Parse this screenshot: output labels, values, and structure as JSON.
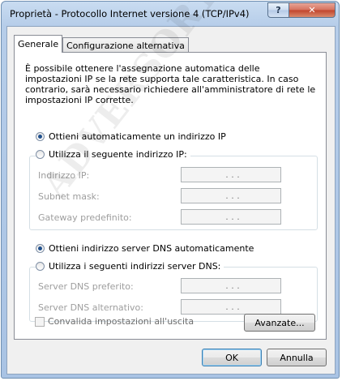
{
  "window": {
    "title": "Proprietà - Protocollo Internet versione 4 (TCP/IPv4)",
    "help_label": "?",
    "close_label": "✕"
  },
  "tabs": [
    {
      "label": "Generale",
      "active": true
    },
    {
      "label": "Configurazione alternativa",
      "active": false
    }
  ],
  "description": "È possibile ottenere l'assegnazione automatica delle impostazioni IP se la rete supporta tale caratteristica. In caso contrario, sarà necessario richiedere all'amministratore di rete le impostazioni IP corrette.",
  "ip": {
    "auto_label": "Ottieni automaticamente un indirizzo IP",
    "auto_checked": true,
    "manual_label": "Utilizza il seguente indirizzo IP:",
    "manual_checked": false,
    "fields": [
      {
        "label": "Indirizzo IP:",
        "value": ". . ."
      },
      {
        "label": "Subnet mask:",
        "value": ". . ."
      },
      {
        "label": "Gateway predefinito:",
        "value": ". . ."
      }
    ]
  },
  "dns": {
    "auto_label": "Ottieni indirizzo server DNS automaticamente",
    "auto_checked": true,
    "manual_label": "Utilizza i seguenti indirizzi server DNS:",
    "manual_checked": false,
    "fields": [
      {
        "label": "Server DNS preferito:",
        "value": ". . ."
      },
      {
        "label": "Server DNS alternativo:",
        "value": ". . ."
      }
    ]
  },
  "validate_label": "Convalida impostazioni all'uscita",
  "advanced_label": "Avanzate...",
  "ok_label": "OK",
  "cancel_label": "Annulla",
  "watermark": "ADVERSORTAUDIT.NET",
  "colors": {
    "accent": "#3c7fb1",
    "title_bar": "#b6cde9",
    "close_button": "#c1432b"
  }
}
